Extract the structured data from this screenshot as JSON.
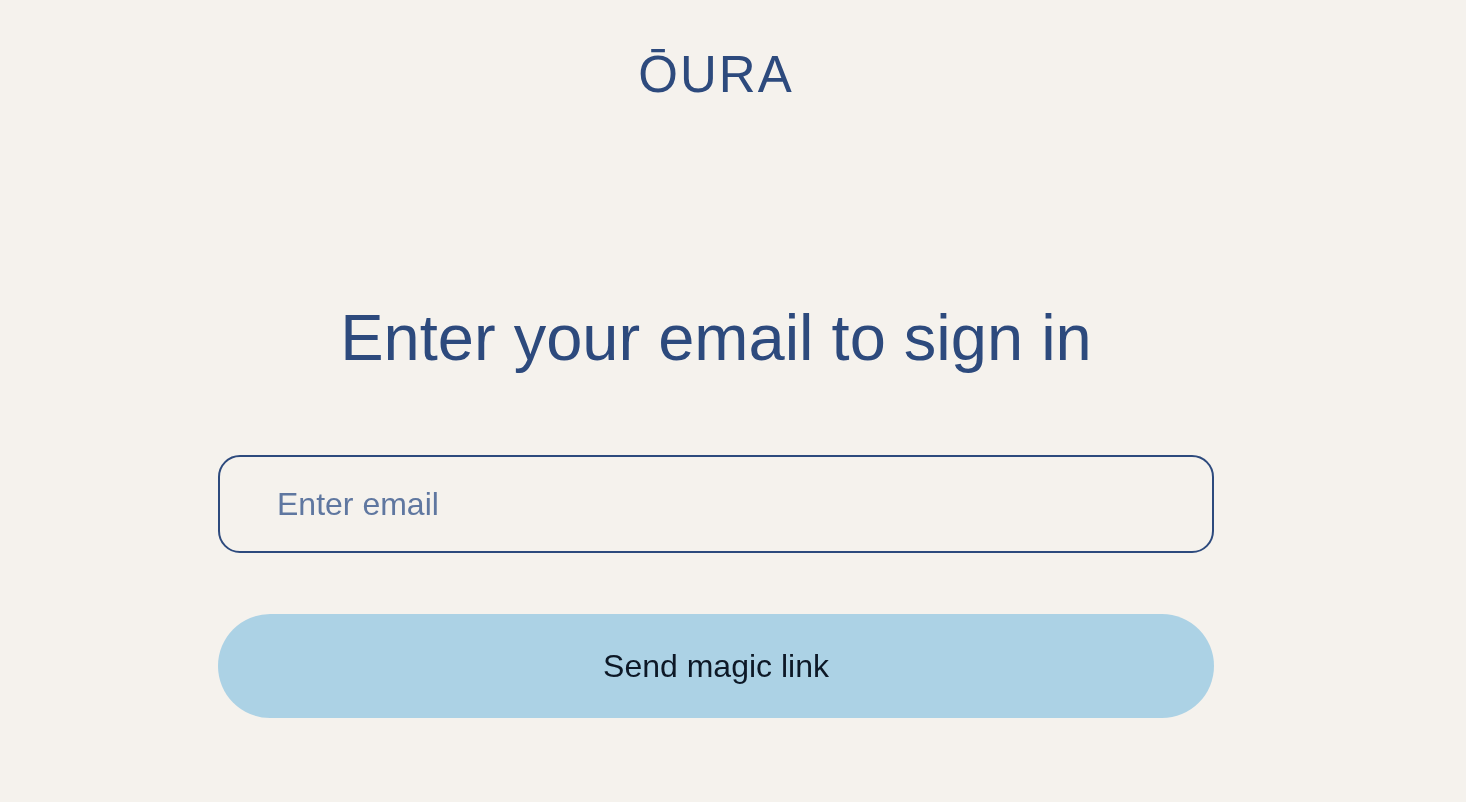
{
  "logo": {
    "text": "ŌURA"
  },
  "heading": "Enter your email to sign in",
  "email_field": {
    "placeholder": "Enter email"
  },
  "submit_button": {
    "label": "Send magic link"
  }
}
